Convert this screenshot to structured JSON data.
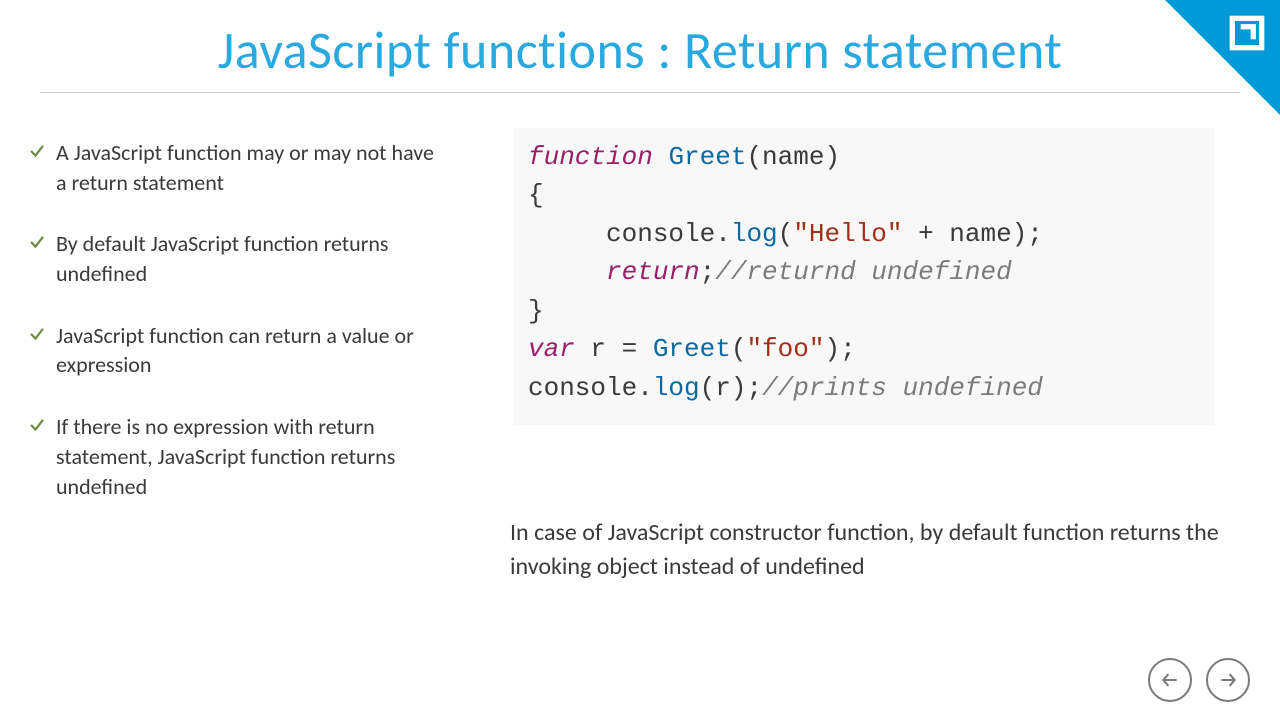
{
  "title": "JavaScript functions : Return statement",
  "bullets": [
    "A JavaScript function may or may not have a return statement",
    "By default JavaScript function returns undefined",
    "JavaScript function can return a value or expression",
    "If there  is no expression with return statement, JavaScript function returns undefined"
  ],
  "code": {
    "kw_function": "function",
    "fn_greet": "Greet",
    "param_open": "(name)",
    "brace_open": "{",
    "indent": "     ",
    "console1_a": "console.",
    "console1_log": "log",
    "console1_b": "(",
    "str_hello": "\"Hello\"",
    "console1_c": " + name);",
    "kw_return": "return",
    "return_tail": ";",
    "cmt_return": "//returnd undefined",
    "brace_close": "}",
    "kw_var": "var",
    "var_decl": " r = ",
    "call_greet": "Greet",
    "call_open": "(",
    "str_foo": "\"foo\"",
    "call_close": ");",
    "console2_a": "console.",
    "console2_log": "log",
    "console2_b": "(r);",
    "cmt_print": "//prints undefined"
  },
  "note": "In case of JavaScript constructor function, by default function returns the invoking object instead of undefined",
  "nav": {
    "prev": "Previous",
    "next": "Next"
  }
}
